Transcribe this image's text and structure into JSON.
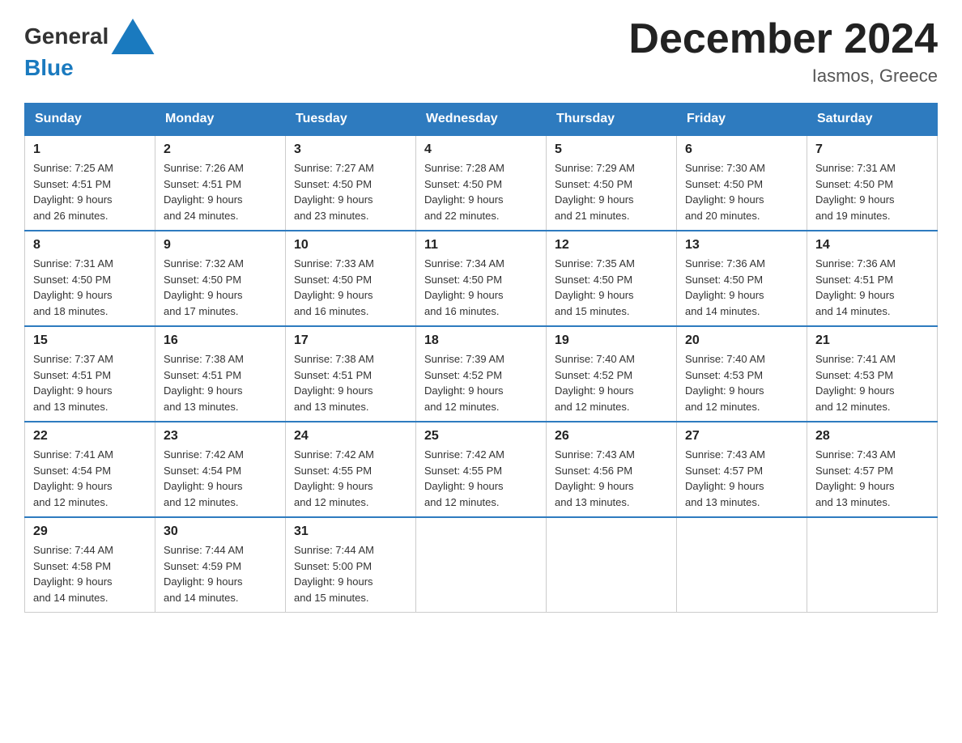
{
  "header": {
    "logo_general": "General",
    "logo_blue": "Blue",
    "month_title": "December 2024",
    "location": "Iasmos, Greece"
  },
  "days_of_week": [
    "Sunday",
    "Monday",
    "Tuesday",
    "Wednesday",
    "Thursday",
    "Friday",
    "Saturday"
  ],
  "weeks": [
    [
      {
        "num": "1",
        "sunrise": "7:25 AM",
        "sunset": "4:51 PM",
        "daylight": "9 hours and 26 minutes."
      },
      {
        "num": "2",
        "sunrise": "7:26 AM",
        "sunset": "4:51 PM",
        "daylight": "9 hours and 24 minutes."
      },
      {
        "num": "3",
        "sunrise": "7:27 AM",
        "sunset": "4:50 PM",
        "daylight": "9 hours and 23 minutes."
      },
      {
        "num": "4",
        "sunrise": "7:28 AM",
        "sunset": "4:50 PM",
        "daylight": "9 hours and 22 minutes."
      },
      {
        "num": "5",
        "sunrise": "7:29 AM",
        "sunset": "4:50 PM",
        "daylight": "9 hours and 21 minutes."
      },
      {
        "num": "6",
        "sunrise": "7:30 AM",
        "sunset": "4:50 PM",
        "daylight": "9 hours and 20 minutes."
      },
      {
        "num": "7",
        "sunrise": "7:31 AM",
        "sunset": "4:50 PM",
        "daylight": "9 hours and 19 minutes."
      }
    ],
    [
      {
        "num": "8",
        "sunrise": "7:31 AM",
        "sunset": "4:50 PM",
        "daylight": "9 hours and 18 minutes."
      },
      {
        "num": "9",
        "sunrise": "7:32 AM",
        "sunset": "4:50 PM",
        "daylight": "9 hours and 17 minutes."
      },
      {
        "num": "10",
        "sunrise": "7:33 AM",
        "sunset": "4:50 PM",
        "daylight": "9 hours and 16 minutes."
      },
      {
        "num": "11",
        "sunrise": "7:34 AM",
        "sunset": "4:50 PM",
        "daylight": "9 hours and 16 minutes."
      },
      {
        "num": "12",
        "sunrise": "7:35 AM",
        "sunset": "4:50 PM",
        "daylight": "9 hours and 15 minutes."
      },
      {
        "num": "13",
        "sunrise": "7:36 AM",
        "sunset": "4:50 PM",
        "daylight": "9 hours and 14 minutes."
      },
      {
        "num": "14",
        "sunrise": "7:36 AM",
        "sunset": "4:51 PM",
        "daylight": "9 hours and 14 minutes."
      }
    ],
    [
      {
        "num": "15",
        "sunrise": "7:37 AM",
        "sunset": "4:51 PM",
        "daylight": "9 hours and 13 minutes."
      },
      {
        "num": "16",
        "sunrise": "7:38 AM",
        "sunset": "4:51 PM",
        "daylight": "9 hours and 13 minutes."
      },
      {
        "num": "17",
        "sunrise": "7:38 AM",
        "sunset": "4:51 PM",
        "daylight": "9 hours and 13 minutes."
      },
      {
        "num": "18",
        "sunrise": "7:39 AM",
        "sunset": "4:52 PM",
        "daylight": "9 hours and 12 minutes."
      },
      {
        "num": "19",
        "sunrise": "7:40 AM",
        "sunset": "4:52 PM",
        "daylight": "9 hours and 12 minutes."
      },
      {
        "num": "20",
        "sunrise": "7:40 AM",
        "sunset": "4:53 PM",
        "daylight": "9 hours and 12 minutes."
      },
      {
        "num": "21",
        "sunrise": "7:41 AM",
        "sunset": "4:53 PM",
        "daylight": "9 hours and 12 minutes."
      }
    ],
    [
      {
        "num": "22",
        "sunrise": "7:41 AM",
        "sunset": "4:54 PM",
        "daylight": "9 hours and 12 minutes."
      },
      {
        "num": "23",
        "sunrise": "7:42 AM",
        "sunset": "4:54 PM",
        "daylight": "9 hours and 12 minutes."
      },
      {
        "num": "24",
        "sunrise": "7:42 AM",
        "sunset": "4:55 PM",
        "daylight": "9 hours and 12 minutes."
      },
      {
        "num": "25",
        "sunrise": "7:42 AM",
        "sunset": "4:55 PM",
        "daylight": "9 hours and 12 minutes."
      },
      {
        "num": "26",
        "sunrise": "7:43 AM",
        "sunset": "4:56 PM",
        "daylight": "9 hours and 13 minutes."
      },
      {
        "num": "27",
        "sunrise": "7:43 AM",
        "sunset": "4:57 PM",
        "daylight": "9 hours and 13 minutes."
      },
      {
        "num": "28",
        "sunrise": "7:43 AM",
        "sunset": "4:57 PM",
        "daylight": "9 hours and 13 minutes."
      }
    ],
    [
      {
        "num": "29",
        "sunrise": "7:44 AM",
        "sunset": "4:58 PM",
        "daylight": "9 hours and 14 minutes."
      },
      {
        "num": "30",
        "sunrise": "7:44 AM",
        "sunset": "4:59 PM",
        "daylight": "9 hours and 14 minutes."
      },
      {
        "num": "31",
        "sunrise": "7:44 AM",
        "sunset": "5:00 PM",
        "daylight": "9 hours and 15 minutes."
      },
      null,
      null,
      null,
      null
    ]
  ],
  "labels": {
    "sunrise": "Sunrise:",
    "sunset": "Sunset:",
    "daylight": "Daylight:"
  }
}
